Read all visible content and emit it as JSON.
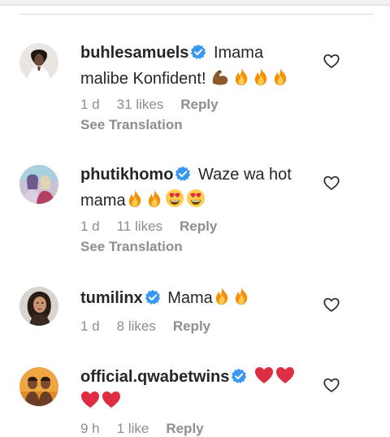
{
  "comments": [
    {
      "username": "buhlesamuels",
      "text_line1": "Imama",
      "text_line2": "malibe Konfident!",
      "time": "1 d",
      "likes": "31 likes",
      "reply": "Reply",
      "see_translation": "See Translation",
      "emoji": [
        "flexed-biceps-icon",
        "fire-icon",
        "fire-icon",
        "fire-icon"
      ]
    },
    {
      "username": "phutikhomo",
      "text_line1": "Waze wa hot",
      "text_line2": "mama",
      "time": "1 d",
      "likes": "11 likes",
      "reply": "Reply",
      "see_translation": "See Translation",
      "emoji": [
        "fire-icon",
        "fire-icon",
        "heart-eyes-icon",
        "heart-eyes-icon"
      ]
    },
    {
      "username": "tumilinx",
      "text_line1": "Mama",
      "time": "1 d",
      "likes": "8 likes",
      "reply": "Reply",
      "emoji": [
        "fire-icon",
        "fire-icon"
      ]
    },
    {
      "username": "official.qwabetwins",
      "text_line1": "",
      "time": "9 h",
      "likes": "1 like",
      "reply": "Reply",
      "emoji": [
        "red-heart-icon",
        "red-heart-icon",
        "red-heart-icon",
        "red-heart-icon"
      ]
    }
  ],
  "colors": {
    "verified": "#3897f0",
    "muted": "#8e8e8e",
    "text": "#262626"
  }
}
